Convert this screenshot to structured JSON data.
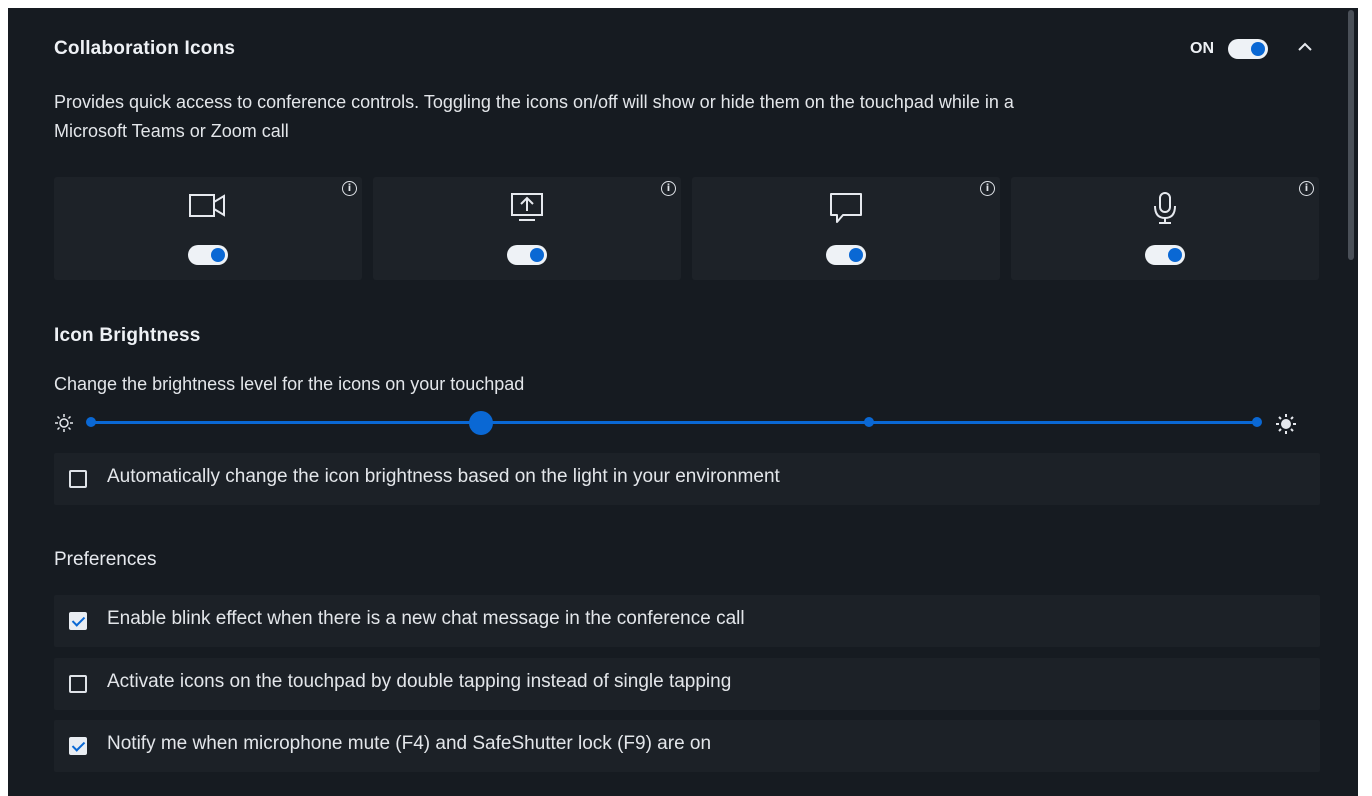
{
  "header": {
    "title": "Collaboration Icons",
    "status": "ON",
    "description_line1": "Provides quick access to conference controls. Toggling the icons on/off will show or hide them on the touchpad while in a",
    "description_line2": "Microsoft Teams or Zoom call"
  },
  "icon_cards": [
    {
      "icon": "video-camera-icon",
      "enabled": true
    },
    {
      "icon": "share-screen-icon",
      "enabled": true
    },
    {
      "icon": "chat-icon",
      "enabled": true
    },
    {
      "icon": "microphone-icon",
      "enabled": true
    }
  ],
  "brightness": {
    "title": "Icon Brightness",
    "description": "Change the brightness level for the icons on your touchpad",
    "level_index": 1,
    "levels": 4,
    "auto_label": "Automatically change the icon brightness based on the light in your environment",
    "auto_checked": false
  },
  "preferences": {
    "title": "Preferences",
    "items": [
      {
        "label": "Enable blink effect when there is a new chat message in the conference call",
        "checked": true
      },
      {
        "label": "Activate icons on the touchpad by double tapping instead of single tapping",
        "checked": false
      },
      {
        "label": "Notify me when microphone mute (F4) and SafeShutter lock (F9) are on",
        "checked": true
      }
    ]
  },
  "colors": {
    "background": "#161b21",
    "card": "#1d2228",
    "accent": "#0a68d4",
    "text": "#e3e6ea"
  }
}
